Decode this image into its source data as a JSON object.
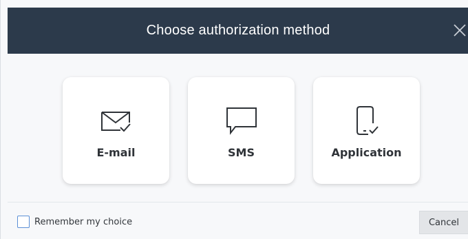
{
  "dialog": {
    "title": "Choose authorization method",
    "close_icon": "close-icon"
  },
  "options": [
    {
      "label": "E-mail",
      "icon": "envelope-check-icon"
    },
    {
      "label": "SMS",
      "icon": "speech-bubble-icon"
    },
    {
      "label": "Application",
      "icon": "phone-check-icon"
    }
  ],
  "footer": {
    "remember_label": "Remember my choice",
    "remember_checked": false,
    "cancel_label": "Cancel"
  },
  "colors": {
    "header_bg": "#2c3a4b",
    "header_text": "#ffffff",
    "body_bg": "#f7f8fa",
    "card_bg": "#ffffff",
    "checkbox_border": "#5b8fd6",
    "button_bg": "#e3e5e8"
  }
}
